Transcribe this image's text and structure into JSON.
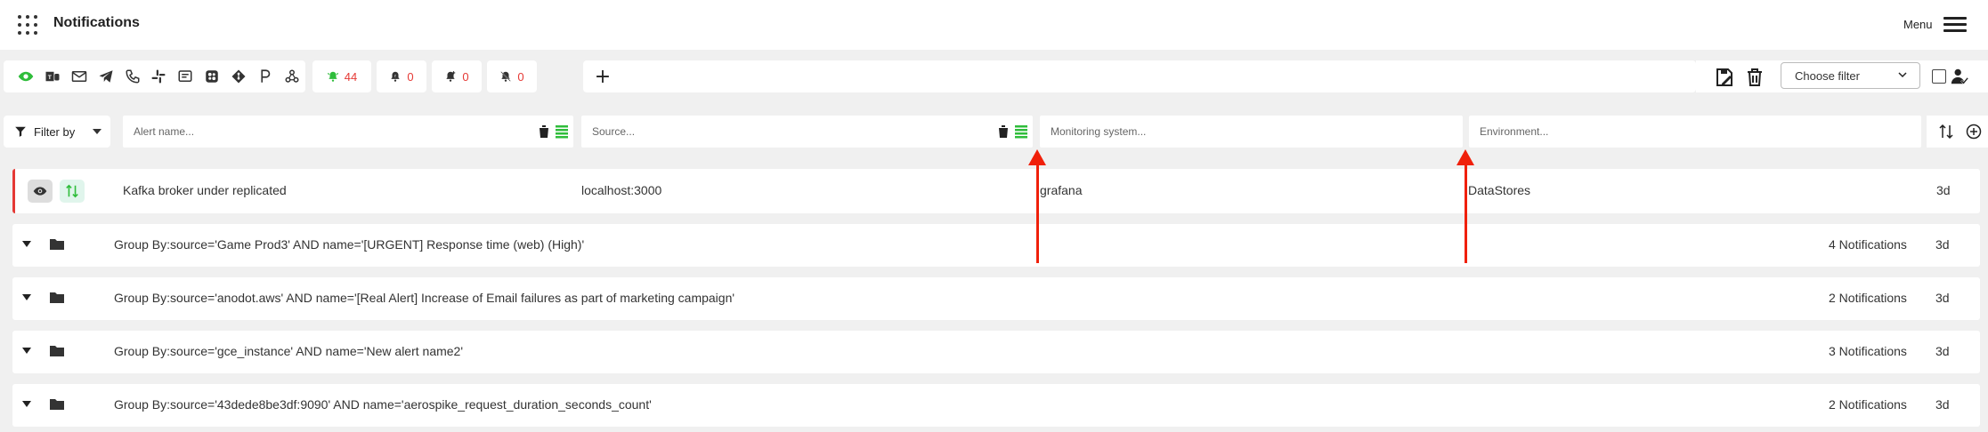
{
  "header": {
    "title": "Notifications",
    "menu_label": "Menu"
  },
  "toolbar": {
    "channels": [
      {
        "icon": "eye-icon",
        "color": "#2fbd3b"
      },
      {
        "icon": "teams-icon"
      },
      {
        "icon": "envelope-icon"
      },
      {
        "icon": "telegram-icon"
      },
      {
        "icon": "phone-icon"
      },
      {
        "icon": "slack-icon"
      },
      {
        "icon": "message-icon"
      },
      {
        "icon": "chart-icon"
      },
      {
        "icon": "git-icon"
      },
      {
        "icon": "pagerduty-icon"
      },
      {
        "icon": "webhook-icon"
      }
    ],
    "counters": [
      {
        "icon": "bell-ringing-icon",
        "value": "44",
        "icon_color": "#2fbd3b"
      },
      {
        "icon": "bell-snooze-icon",
        "value": "0"
      },
      {
        "icon": "bell-plus-icon",
        "value": "0"
      },
      {
        "icon": "bell-off-icon",
        "value": "0"
      }
    ],
    "add_label": "+",
    "filter_select": "Choose filter"
  },
  "filters": {
    "filter_by_label": "Filter by",
    "alert_name_placeholder": "Alert name...",
    "source_placeholder": "Source...",
    "monitoring_placeholder": "Monitoring system...",
    "environment_placeholder": "Environment..."
  },
  "alert": {
    "name": "Kafka broker under replicated",
    "source": "localhost:3000",
    "monitoring_system": "grafana",
    "environment": "DataStores",
    "age": "3d"
  },
  "groups": [
    {
      "text": "Group By:source='Game Prod3' AND name='[URGENT] Response time (web) (High)'",
      "count": "4 Notifications",
      "age": "3d"
    },
    {
      "text": "Group By:source='anodot.aws' AND name='[Real Alert] Increase of Email failures as part of marketing campaign'",
      "count": "2 Notifications",
      "age": "3d"
    },
    {
      "text": "Group By:source='gce_instance' AND name='New alert name2'",
      "count": "3 Notifications",
      "age": "3d"
    },
    {
      "text": "Group By:source='43dede8be3df:9090' AND name='aerospike_request_duration_seconds_count'",
      "count": "2 Notifications",
      "age": "3d"
    }
  ],
  "colors": {
    "accent_green": "#2fbd3b",
    "alert_red": "#e53935",
    "annotation_arrow": "#f0200a"
  }
}
